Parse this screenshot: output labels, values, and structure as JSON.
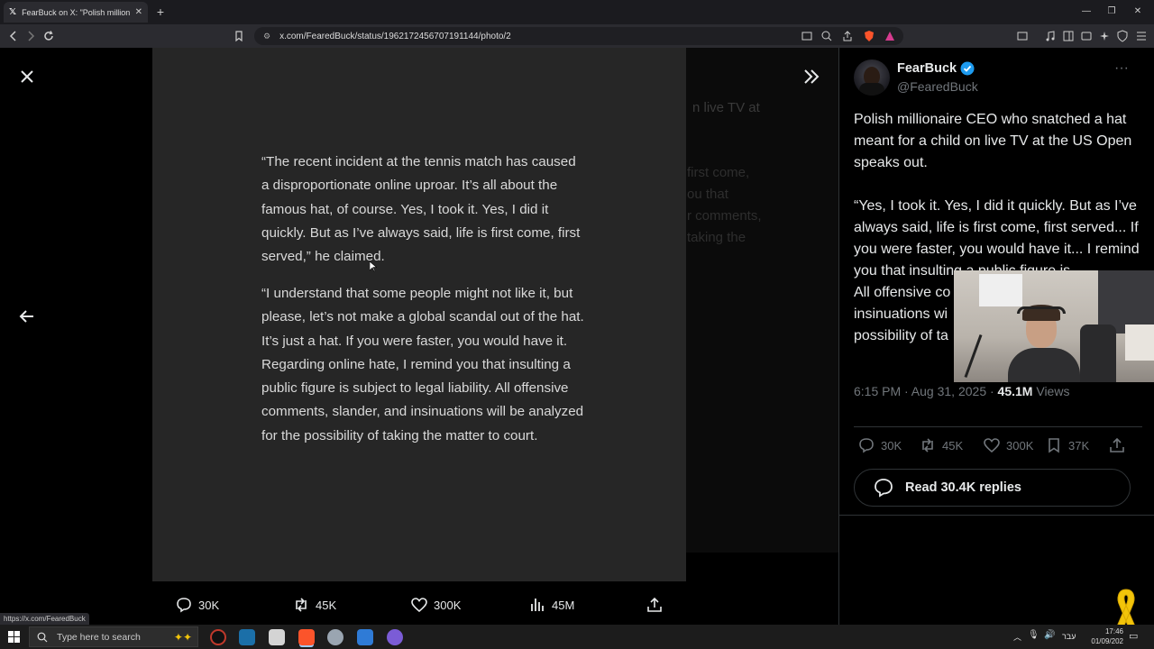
{
  "browser": {
    "tab_title": "FearBuck on X: \"Polish millionai",
    "url": "x.com/FearedBuck/status/1962172456707191144/photo/2",
    "status_url": "https://x.com/FearedBuck"
  },
  "viewer": {
    "paragraph_1": "“The recent incident at the tennis match has caused a disproportionate online uproar. It’s all about the famous hat, of course. Yes, I took it. Yes, I did it quickly. But as I’ve always said, life is first come, first served,” he claimed.",
    "paragraph_2": "“I understand that some people might not like it, but please, let’s not make a global scandal out of the hat. It’s just a hat. If you were faster, you would have it. Regarding online hate, I remind you that insulting a public figure is subject to legal liability. All offensive comments, slander, and insinuations will be analyzed for the possibility of taking the matter to court.",
    "bg_fragment_1": "n live TV at",
    "bg_fragment_2": "first come,",
    "bg_fragment_3": "ou that",
    "bg_fragment_4": "r comments,",
    "bg_fragment_5": "taking the",
    "actions": {
      "replies": "30K",
      "reposts": "45K",
      "likes": "300K",
      "views": "45M"
    }
  },
  "tweet": {
    "author_name": "FearBuck",
    "author_handle": "@FearedBuck",
    "text_1": "Polish millionaire CEO who snatched a hat meant for a child on live TV at the US Open speaks out.",
    "text_2": "“Yes, I took it. Yes, I did it quickly. But as I’ve always said, life is first come, first served... If you were faster, you would have it... I remind you that insulting a public figure is",
    "text_3": "All offensive co",
    "text_4": "insinuations wi",
    "text_5": "possibility of ta",
    "time": "6:15 PM · Aug 31, 2025 · ",
    "views_count": "45.1M",
    "views_label": " Views",
    "stats": {
      "replies": "30K",
      "reposts": "45K",
      "likes": "300K",
      "bookmarks": "37K"
    },
    "read_replies": "Read 30.4K replies"
  },
  "taskbar": {
    "search_placeholder": "Type here to search",
    "time": "17:46",
    "date": "01/09/202",
    "lang": "עבר"
  },
  "colors": {
    "accent": "#1d9bf0",
    "brave": "#fb542b"
  }
}
